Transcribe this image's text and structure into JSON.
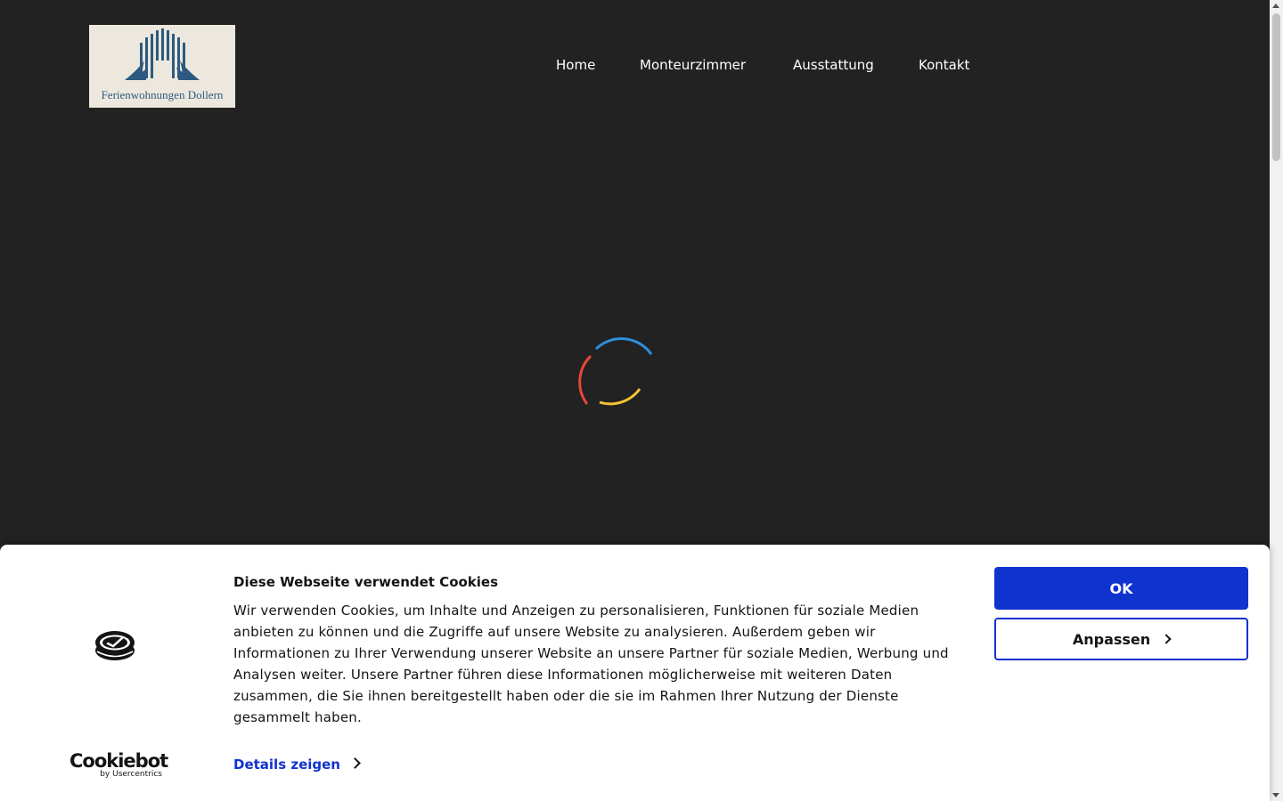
{
  "header": {
    "logo_text": "Ferienwohnungen Dollern",
    "nav": [
      {
        "label": "Home"
      },
      {
        "label": "Monteurzimmer"
      },
      {
        "label": "Ausstattung"
      },
      {
        "label": "Kontakt"
      }
    ]
  },
  "loader": {
    "icon": "loading-spinner-icon",
    "colors": [
      "#2f8fd8",
      "#e8463a",
      "#f5c232"
    ]
  },
  "cookie_banner": {
    "brand_name": "Cookiebot",
    "brand_sub": "by Usercentrics",
    "title": "Diese Webseite verwendet Cookies",
    "text": "Wir verwenden Cookies, um Inhalte und Anzeigen zu personalisieren, Funktionen für soziale Medien anbieten zu können und die Zugriffe auf unsere Website zu analysieren. Außerdem geben wir Informationen zu Ihrer Verwendung unserer Website an unsere Partner für soziale Medien, Werbung und Analysen weiter. Unsere Partner führen diese Informationen möglicherweise mit weiteren Daten zusammen, die Sie ihnen bereitgestellt haben oder die sie im Rahmen Ihrer Nutzung der Dienste gesammelt haben.",
    "details_label": "Details zeigen",
    "ok_label": "OK",
    "customize_label": "Anpassen",
    "accent_color": "#1032cf"
  }
}
